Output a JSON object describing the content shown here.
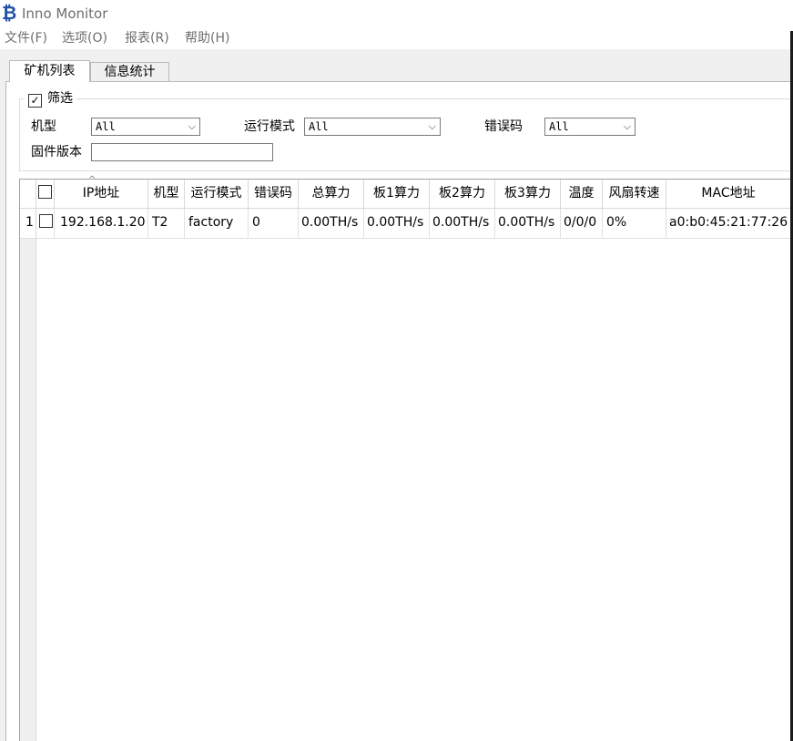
{
  "window": {
    "title": "Inno Monitor",
    "icon": "bitcoin-icon",
    "icon_glyph": "₿"
  },
  "menu": {
    "file": "文件(F)",
    "options": "选项(O)",
    "reports": "报表(R)",
    "help": "帮助(H)"
  },
  "tabs": {
    "miners": "矿机列表",
    "stats": "信息统计"
  },
  "filter": {
    "label": "筛选",
    "checked": true,
    "check_glyph": "✓",
    "model_label": "机型",
    "model_value": "All",
    "mode_label": "运行模式",
    "mode_value": "All",
    "error_label": "错误码",
    "error_value": "All",
    "firmware_label": "固件版本",
    "firmware_value": "",
    "dropdown_glyph": "⌵"
  },
  "table": {
    "sort_caret": "^",
    "headers": [
      "IP地址",
      "机型",
      "运行模式",
      "错误码",
      "总算力",
      "板1算力",
      "板2算力",
      "板3算力",
      "温度",
      "风扇转速",
      "MAC地址"
    ],
    "rows": [
      {
        "num": "1",
        "cells": [
          "192.168.1.20",
          "T2",
          "factory",
          "0",
          "0.00TH/s",
          "0.00TH/s",
          "0.00TH/s",
          "0.00TH/s",
          "0/0/0",
          "0%",
          "a0:b0:45:21:77:26"
        ]
      }
    ]
  }
}
